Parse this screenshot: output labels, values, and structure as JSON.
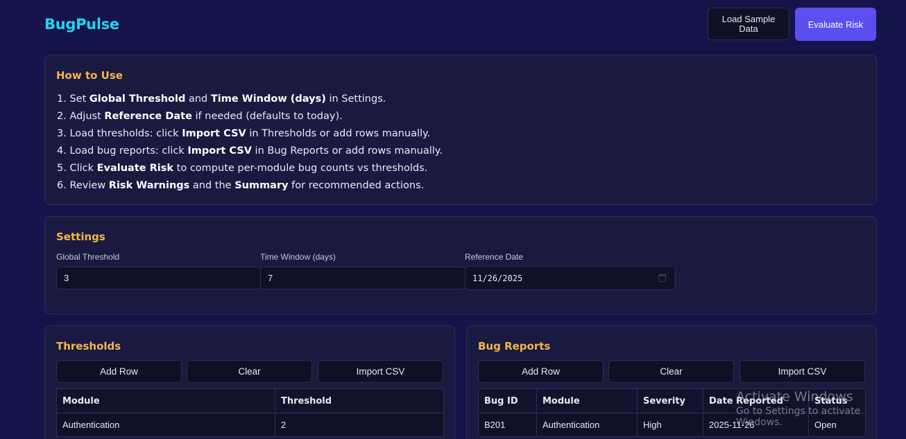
{
  "header": {
    "brand": "BugPulse",
    "load_sample_label": "Load Sample Data",
    "evaluate_label": "Evaluate Risk"
  },
  "howto": {
    "title": "How to Use",
    "steps": [
      [
        {
          "t": "1. Set "
        },
        {
          "t": "Global Threshold",
          "b": true
        },
        {
          "t": " and "
        },
        {
          "t": "Time Window (days)",
          "b": true
        },
        {
          "t": " in Settings."
        }
      ],
      [
        {
          "t": "2. Adjust "
        },
        {
          "t": "Reference Date",
          "b": true
        },
        {
          "t": " if needed (defaults to today)."
        }
      ],
      [
        {
          "t": "3. Load thresholds: click "
        },
        {
          "t": "Import CSV",
          "b": true
        },
        {
          "t": " in Thresholds or add rows manually."
        }
      ],
      [
        {
          "t": "4. Load bug reports: click "
        },
        {
          "t": "Import CSV",
          "b": true
        },
        {
          "t": " in Bug Reports or add rows manually."
        }
      ],
      [
        {
          "t": "5. Click "
        },
        {
          "t": "Evaluate Risk",
          "b": true
        },
        {
          "t": " to compute per-module bug counts vs thresholds."
        }
      ],
      [
        {
          "t": "6. Review "
        },
        {
          "t": "Risk Warnings",
          "b": true
        },
        {
          "t": " and the "
        },
        {
          "t": "Summary",
          "b": true
        },
        {
          "t": " for recommended actions."
        }
      ]
    ]
  },
  "settings": {
    "title": "Settings",
    "global_threshold_label": "Global Threshold",
    "global_threshold_value": "3",
    "time_window_label": "Time Window (days)",
    "time_window_value": "7",
    "reference_date_label": "Reference Date",
    "reference_date_value": "11/26/2025"
  },
  "thresholds": {
    "title": "Thresholds",
    "add_row": "Add Row",
    "clear": "Clear",
    "import_csv": "Import CSV",
    "columns": [
      "Module",
      "Threshold"
    ],
    "rows": [
      [
        "Authentication",
        "2"
      ]
    ]
  },
  "bugs": {
    "title": "Bug Reports",
    "add_row": "Add Row",
    "clear": "Clear",
    "import_csv": "Import CSV",
    "columns": [
      "Bug ID",
      "Module",
      "Severity",
      "Date Reported",
      "Status"
    ],
    "rows": [
      [
        "B201",
        "Authentication",
        "High",
        "2025-11-26",
        "Open"
      ]
    ]
  },
  "watermark": {
    "line1": "Activate Windows",
    "line2": "Go to Settings to activate Windows."
  }
}
